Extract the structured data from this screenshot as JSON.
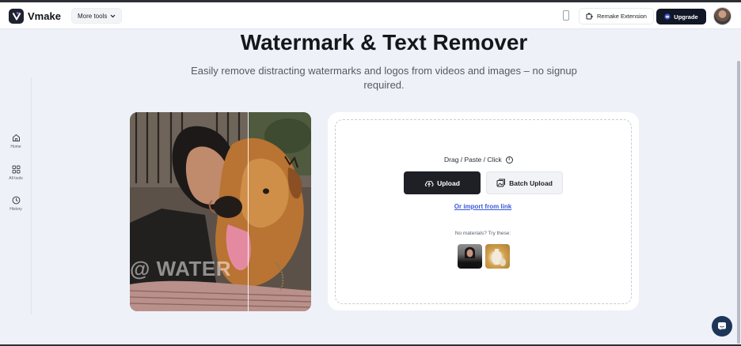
{
  "header": {
    "brand": "Vmake",
    "more_tools_label": "More tools",
    "remake_extension_label": "Remake Extension",
    "upgrade_label": "Upgrade"
  },
  "sidebar": {
    "items": [
      {
        "label": "Home",
        "icon": "home-icon"
      },
      {
        "label": "All tools",
        "icon": "grid-icon"
      },
      {
        "label": "History",
        "icon": "clock-icon"
      }
    ]
  },
  "main": {
    "title": "Watermark & Text Remover",
    "subtitle": "Easily remove distracting watermarks and logos from videos and images – no signup required.",
    "preview_watermark_text": "@ WATER"
  },
  "upload": {
    "drag_text": "Drag / Paste / Click",
    "upload_label": "Upload",
    "batch_upload_label": "Batch Upload",
    "import_link_label": "Or import from link",
    "samples_label": "No materials? Try these:"
  },
  "colors": {
    "accent_dark": "#121726",
    "link_blue": "#3c59d6",
    "page_bg": "#eef1f8",
    "chat_button": "#1d3557"
  }
}
